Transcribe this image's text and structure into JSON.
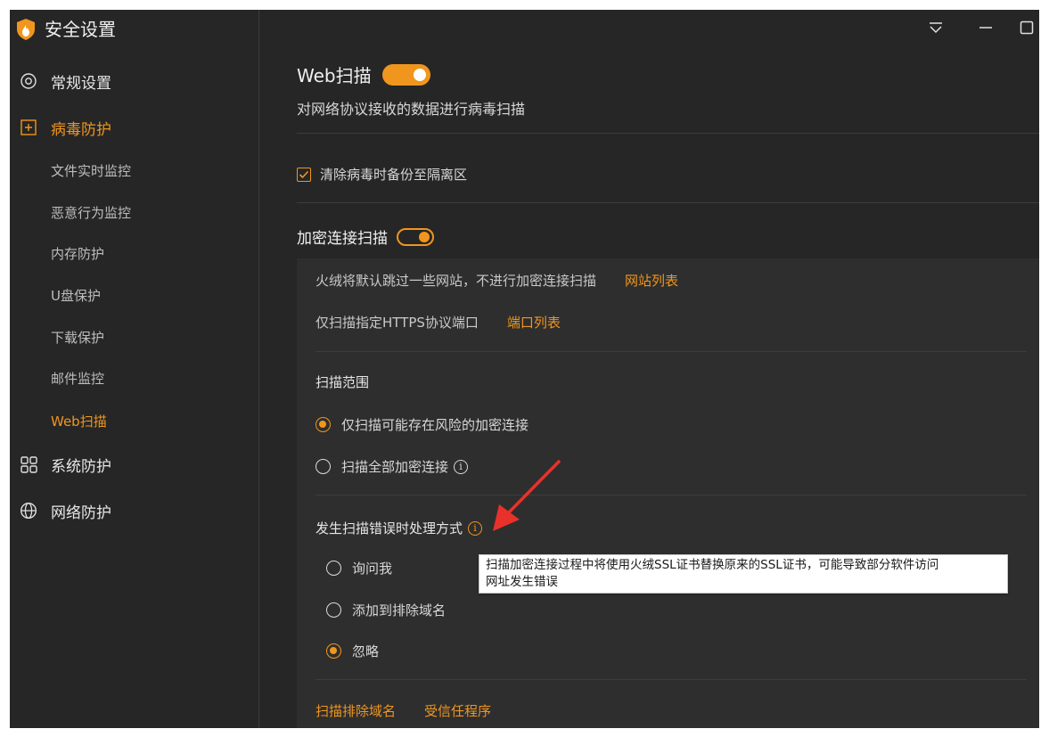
{
  "app": {
    "title": "安全设置"
  },
  "sidebar": {
    "items": [
      {
        "label": "常规设置",
        "icon": "gear-icon"
      },
      {
        "label": "病毒防护",
        "icon": "plus-box-icon"
      },
      {
        "label": "系统防护",
        "icon": "grid-icon"
      },
      {
        "label": "网络防护",
        "icon": "globe-icon"
      }
    ],
    "subitems": [
      {
        "label": "文件实时监控"
      },
      {
        "label": "恶意行为监控"
      },
      {
        "label": "内存防护"
      },
      {
        "label": "U盘保护"
      },
      {
        "label": "下载保护"
      },
      {
        "label": "邮件监控"
      },
      {
        "label": "Web扫描"
      }
    ],
    "active_item": "病毒防护",
    "active_subitem": "Web扫描"
  },
  "window_controls": [
    "menu-icon",
    "minimize-icon",
    "maximize-icon"
  ],
  "main": {
    "web_scan": {
      "title": "Web扫描",
      "enabled": true,
      "description": "对网络协议接收的数据进行病毒扫描"
    },
    "quarantine_checkbox": {
      "label": "清除病毒时备份至隔离区",
      "checked": true
    },
    "encrypted_scan": {
      "title": "加密连接扫描",
      "enabled": true,
      "skip_text": "火绒将默认跳过一些网站，不进行加密连接扫描",
      "site_list_link": "网站列表",
      "port_text": "仅扫描指定HTTPS协议端口",
      "port_list_link": "端口列表",
      "scope_title": "扫描范围",
      "scope_options": [
        {
          "label": "仅扫描可能存在风险的加密连接",
          "selected": true
        },
        {
          "label": "扫描全部加密连接",
          "selected": false
        }
      ],
      "error_title": "发生扫描错误时处理方式",
      "error_options": [
        {
          "label": "询问我",
          "selected": false
        },
        {
          "label": "添加到排除域名",
          "selected": false
        },
        {
          "label": "忽略",
          "selected": true
        }
      ],
      "exclude_domains_link": "扫描排除域名",
      "trusted_programs_link": "受信任程序"
    },
    "tooltip": {
      "line1": "扫描加密连接过程中将使用火绒SSL证书替换原来的SSL证书，可能导致部分软件访问",
      "line2": "网址发生错误"
    }
  },
  "colors": {
    "accent": "#f0961e",
    "background": "#262626",
    "panel": "#2e2e2e",
    "annotation_arrow": "#e8312a"
  }
}
